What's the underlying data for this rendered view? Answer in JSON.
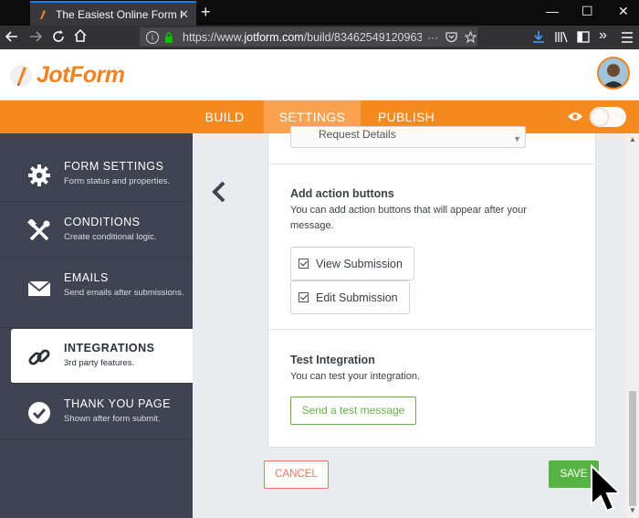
{
  "browser": {
    "tab_title": "The Easiest Online Form Builder",
    "tab_close": "✕",
    "new_tab": "+",
    "win_minimize": "—",
    "win_maximize": "☐",
    "win_close": "✕",
    "url_prefix": "https://www.",
    "url_domain": "jotform.com",
    "url_path": "/build/83462549120963",
    "url_more": "···",
    "icons": [
      "back-arrow",
      "forward-arrow",
      "reload",
      "home",
      "site-info",
      "lock",
      "pocket",
      "bookmark-star",
      "download",
      "library",
      "sidebar",
      "overflow",
      "menu"
    ]
  },
  "header": {
    "logo_text": "JotForm",
    "avatar_label": "user avatar"
  },
  "nav": {
    "tabs": [
      {
        "label": "BUILD",
        "active": false
      },
      {
        "label": "SETTINGS",
        "active": true
      },
      {
        "label": "PUBLISH",
        "active": false
      }
    ]
  },
  "sidebar": {
    "items": [
      {
        "title": "FORM SETTINGS",
        "desc": "Form status and properties.",
        "icon": "gear-icon"
      },
      {
        "title": "CONDITIONS",
        "desc": "Create conditional logic.",
        "icon": "tools-icon"
      },
      {
        "title": "EMAILS",
        "desc": "Send emails after submissions.",
        "icon": "envelope-icon"
      },
      {
        "title": "INTEGRATIONS",
        "desc": "3rd party features.",
        "icon": "link-icon",
        "active": true
      },
      {
        "title": "THANK YOU PAGE",
        "desc": "Shown after form submit.",
        "icon": "checkmark-circle-icon"
      }
    ]
  },
  "panel": {
    "select_value": "Request Details",
    "actions": {
      "title": "Add action buttons",
      "desc": "You can add action buttons that will appear after your message.",
      "buttons": [
        {
          "label": "View Submission",
          "checked": true
        },
        {
          "label": "Edit Submission",
          "checked": true
        }
      ]
    },
    "test": {
      "title": "Test Integration",
      "desc": "You can test your integration.",
      "button": "Send a test message"
    },
    "cancel": "CANCEL",
    "save": "SAVE"
  },
  "colors": {
    "brand_orange": "#f68a1f",
    "sidebar_bg": "#3e4451",
    "save_green": "#58b345",
    "cancel_red": "#e8775b"
  }
}
